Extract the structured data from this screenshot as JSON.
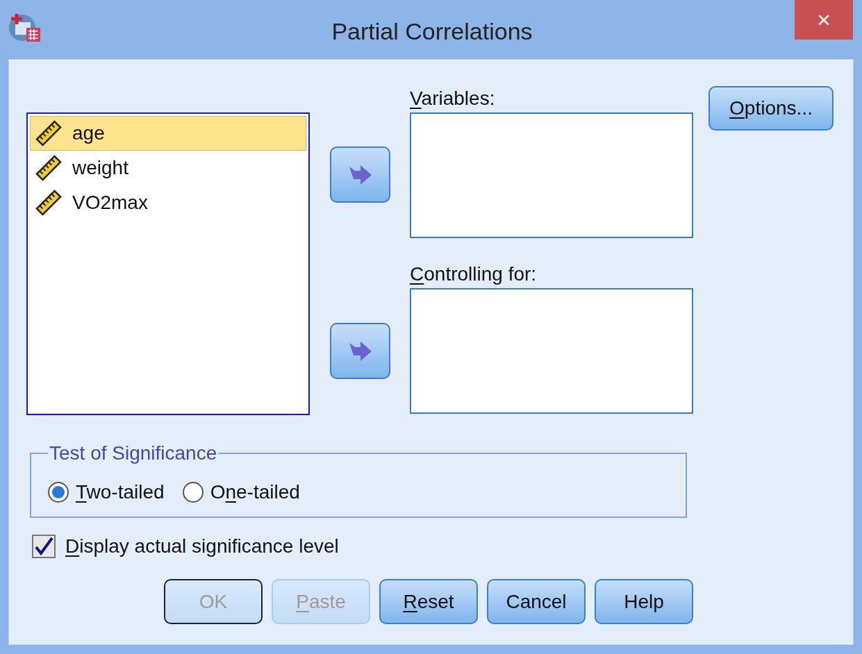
{
  "window": {
    "title": "Partial Correlations",
    "close": "×"
  },
  "source_list": {
    "items": [
      {
        "label": "age",
        "selected": true
      },
      {
        "label": "weight",
        "selected": false
      },
      {
        "label": "VO2max",
        "selected": false
      }
    ]
  },
  "targets": [
    {
      "label": [
        {
          "text": "V",
          "underline": true
        },
        {
          "text": "ariables:",
          "underline": false
        }
      ]
    },
    {
      "label": [
        {
          "text": "C",
          "underline": true
        },
        {
          "text": "ontrolling for:",
          "underline": false
        }
      ]
    }
  ],
  "options_button": {
    "label": [
      {
        "text": "O",
        "underline": true
      },
      {
        "text": "ptions...",
        "underline": false
      }
    ]
  },
  "test_of_significance": {
    "legend": "Test of Significance",
    "options": [
      {
        "label": [
          {
            "text": "T",
            "underline": true
          },
          {
            "text": "wo-tailed",
            "underline": false
          }
        ],
        "selected": true
      },
      {
        "label": [
          {
            "text": "O",
            "underline": false
          },
          {
            "text": "n",
            "underline": true
          },
          {
            "text": "e-tailed",
            "underline": false
          }
        ],
        "selected": false
      }
    ]
  },
  "display_actual": {
    "label": [
      {
        "text": "D",
        "underline": true
      },
      {
        "text": "isplay actual significance level",
        "underline": false
      }
    ],
    "checked": true
  },
  "buttons": [
    {
      "label": [
        {
          "text": "OK",
          "underline": false
        }
      ],
      "disabled": true,
      "default": true
    },
    {
      "label": [
        {
          "text": "P",
          "underline": true
        },
        {
          "text": "aste",
          "underline": false
        }
      ],
      "disabled": true,
      "default": false
    },
    {
      "label": [
        {
          "text": "R",
          "underline": true
        },
        {
          "text": "eset",
          "underline": false
        }
      ],
      "disabled": false,
      "default": false
    },
    {
      "label": [
        {
          "text": "Cancel",
          "underline": false
        }
      ],
      "disabled": false,
      "default": false
    },
    {
      "label": [
        {
          "text": "Help",
          "underline": false
        }
      ],
      "disabled": false,
      "default": false
    }
  ]
}
